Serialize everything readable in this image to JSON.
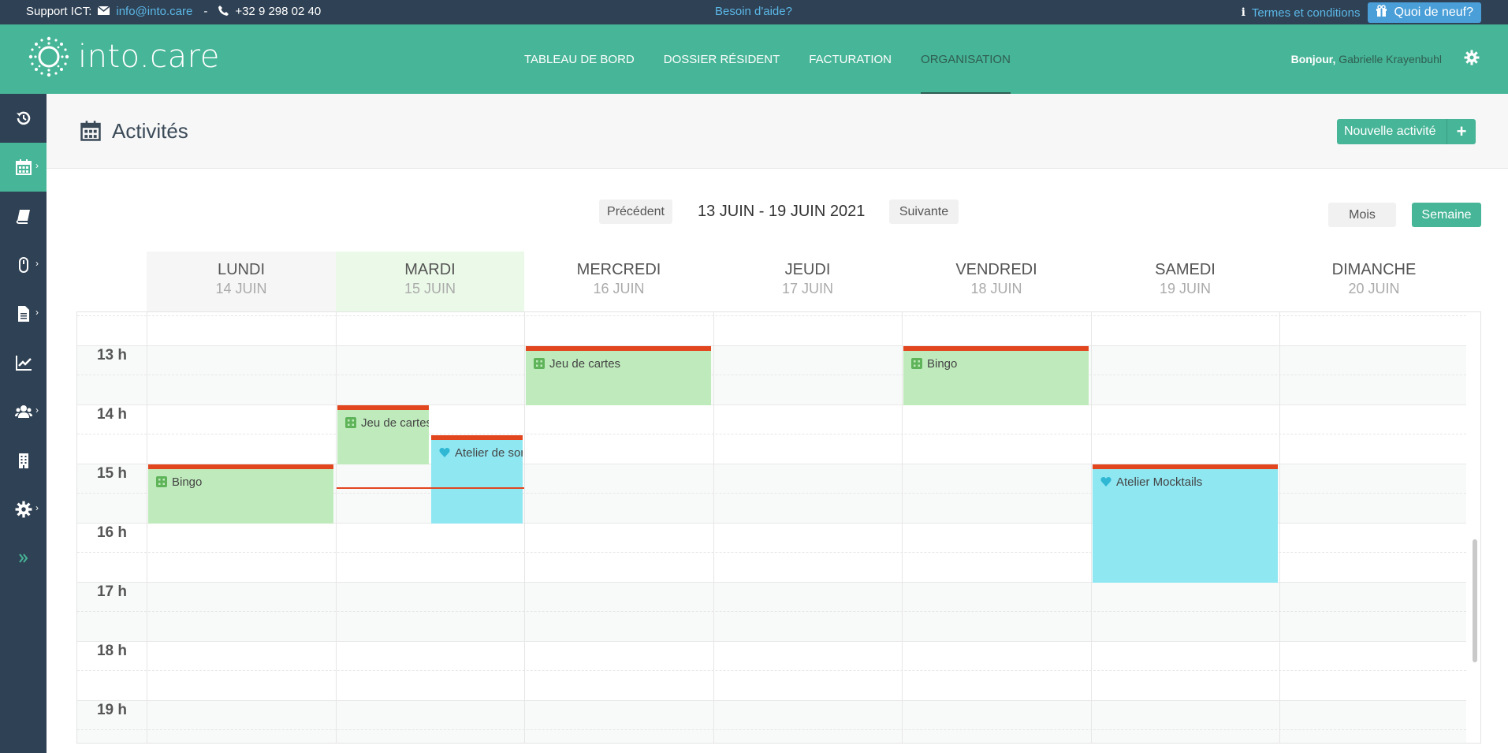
{
  "topbar": {
    "support_label": "Support ICT:",
    "email": "info@into.care",
    "separator": "-",
    "phone": "+32 9 298 02 40",
    "help": "Besoin d'aide?",
    "terms": "Termes et conditions",
    "whats_new": "Quoi de neuf?"
  },
  "header": {
    "brand": "into.care",
    "nav": [
      {
        "label": "TABLEAU DE BORD"
      },
      {
        "label": "DOSSIER RÉSIDENT"
      },
      {
        "label": "FACTURATION"
      },
      {
        "label": "ORGANISATION",
        "active": true
      }
    ],
    "greeting": "Bonjour,",
    "user_name": "Gabrielle Krayenbuhl"
  },
  "sidebar": {
    "items": [
      {
        "icon": "history-icon"
      },
      {
        "icon": "calendar-icon",
        "active": true,
        "has_submenu": true
      },
      {
        "icon": "book-icon"
      },
      {
        "icon": "mouse-icon",
        "has_submenu": true
      },
      {
        "icon": "document-icon",
        "has_submenu": true
      },
      {
        "icon": "line-chart-icon"
      },
      {
        "icon": "users-icon",
        "has_submenu": true
      },
      {
        "icon": "building-icon"
      },
      {
        "icon": "gear-icon",
        "has_submenu": true
      },
      {
        "icon": "double-chevron-right-icon"
      }
    ]
  },
  "page": {
    "title": "Activités",
    "new_activity": "Nouvelle activité"
  },
  "calendar": {
    "prev": "Précédent",
    "range": "13 JUIN - 19 JUIN 2021",
    "next": "Suivante",
    "view_month": "Mois",
    "view_week": "Semaine",
    "active_view": "Semaine",
    "days": [
      {
        "name": "LUNDI",
        "date": "14 JUIN"
      },
      {
        "name": "MARDI",
        "date": "15 JUIN",
        "today": true
      },
      {
        "name": "MERCREDI",
        "date": "16 JUIN"
      },
      {
        "name": "JEUDI",
        "date": "17 JUIN"
      },
      {
        "name": "VENDREDI",
        "date": "18 JUIN"
      },
      {
        "name": "SAMEDI",
        "date": "19 JUIN"
      },
      {
        "name": "DIMANCHE",
        "date": "20 JUIN"
      }
    ],
    "hours": [
      "13 h",
      "14 h",
      "15 h",
      "16 h",
      "17 h",
      "18 h",
      "19 h"
    ],
    "events": [
      {
        "title": "Bingo",
        "day": 0,
        "start": 15.0,
        "end": 16.0,
        "category": "game",
        "icon": "dice-icon",
        "color": "#bfebbc"
      },
      {
        "title": "Jeu de cartes",
        "day": 1,
        "start": 14.0,
        "end": 15.0,
        "category": "game",
        "icon": "dice-icon",
        "color": "#bfebbc",
        "column": 0,
        "columns": 2
      },
      {
        "title": "Atelier de sor",
        "day": 1,
        "start": 14.5,
        "end": 16.0,
        "category": "wellness",
        "icon": "heart-icon",
        "color": "#8fe7f2",
        "column": 1,
        "columns": 2
      },
      {
        "title": "Jeu de cartes",
        "day": 2,
        "start": 13.0,
        "end": 14.0,
        "category": "game",
        "icon": "dice-icon",
        "color": "#bfebbc"
      },
      {
        "title": "Bingo",
        "day": 4,
        "start": 13.0,
        "end": 14.0,
        "category": "game",
        "icon": "dice-icon",
        "color": "#bfebbc"
      },
      {
        "title": "Atelier Mocktails",
        "day": 5,
        "start": 15.0,
        "end": 17.0,
        "category": "wellness",
        "icon": "heart-icon",
        "color": "#8fe7f2"
      }
    ],
    "now": {
      "day": 1,
      "time": 15.4
    },
    "colors": {
      "accent": "#47b597",
      "event_border": "#e2461f",
      "dark": "#2f4154"
    }
  }
}
